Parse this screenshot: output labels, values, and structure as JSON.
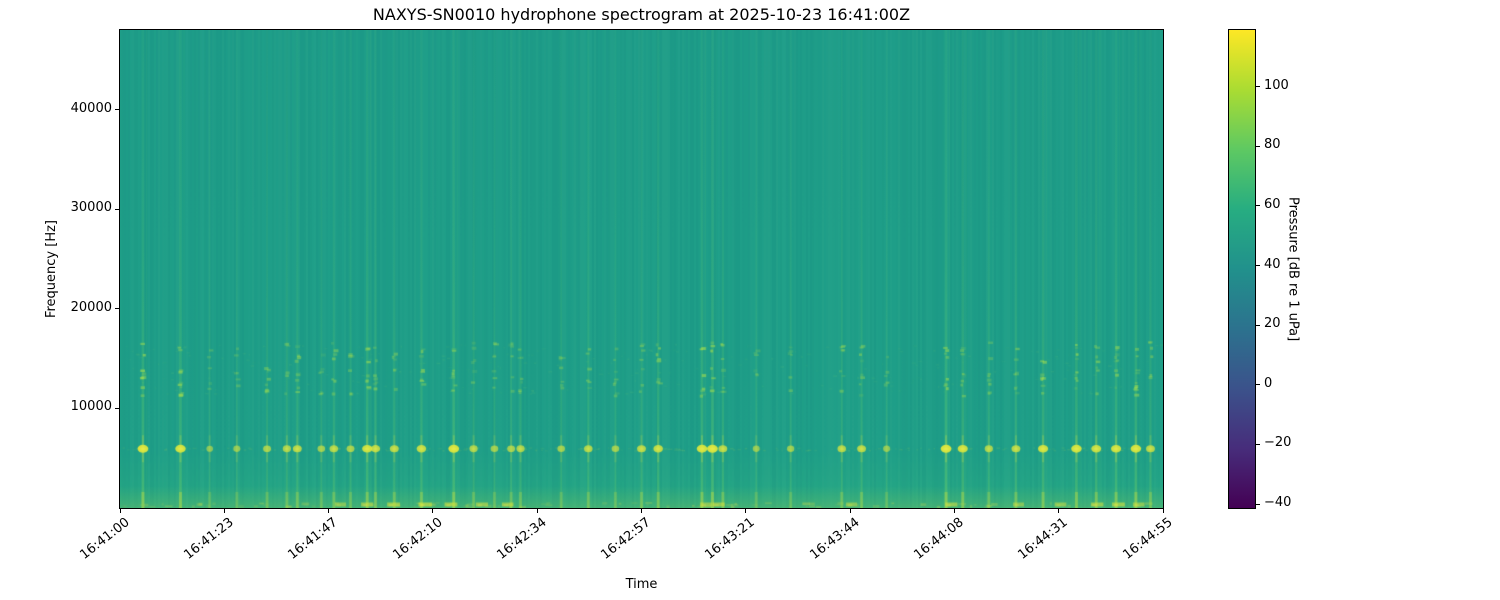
{
  "chart_data": {
    "type": "heatmap",
    "title": "NAXYS-SN0010 hydrophone spectrogram at 2025-10-23 16:41:00Z",
    "xlabel": "Time",
    "ylabel": "Frequency [Hz]",
    "x_ticks": [
      "16:41:00",
      "16:41:23",
      "16:41:47",
      "16:42:10",
      "16:42:34",
      "16:42:57",
      "16:43:21",
      "16:43:44",
      "16:44:08",
      "16:44:31",
      "16:44:55"
    ],
    "y_ticks": [
      10000,
      20000,
      30000,
      40000
    ],
    "freq_range_hz": [
      0,
      48000
    ],
    "colormap": "viridis",
    "background_level_db": 55,
    "tonal_band_hz": 6000,
    "speckle_bands_hz": [
      11800,
      12800,
      13800,
      15200,
      16300
    ],
    "colorbar": {
      "label": "Pressure [dB re 1 uPa]",
      "ticks": [
        100,
        80,
        60,
        40,
        20,
        0,
        -20,
        -40
      ],
      "range": [
        -41,
        119
      ],
      "stops": [
        "#440154",
        "#472d7b",
        "#3b528b",
        "#2c728e",
        "#21918c",
        "#27ad81",
        "#5ec962",
        "#aadc32",
        "#fde725"
      ]
    },
    "background_color": "#1f9f88",
    "streak_color": "#5ec962",
    "blob_color": "#dde52d",
    "events": [
      {
        "t": 0.022,
        "i": 1.0
      },
      {
        "t": 0.058,
        "i": 0.95
      },
      {
        "t": 0.086,
        "i": 0.35
      },
      {
        "t": 0.112,
        "i": 0.4
      },
      {
        "t": 0.141,
        "i": 0.55
      },
      {
        "t": 0.16,
        "i": 0.6
      },
      {
        "t": 0.17,
        "i": 0.7
      },
      {
        "t": 0.193,
        "i": 0.5
      },
      {
        "t": 0.205,
        "i": 0.65
      },
      {
        "t": 0.221,
        "i": 0.55
      },
      {
        "t": 0.237,
        "i": 0.9
      },
      {
        "t": 0.245,
        "i": 0.75
      },
      {
        "t": 0.263,
        "i": 0.7
      },
      {
        "t": 0.289,
        "i": 0.8
      },
      {
        "t": 0.32,
        "i": 1.0
      },
      {
        "t": 0.339,
        "i": 0.6
      },
      {
        "t": 0.359,
        "i": 0.5
      },
      {
        "t": 0.375,
        "i": 0.55
      },
      {
        "t": 0.384,
        "i": 0.6
      },
      {
        "t": 0.423,
        "i": 0.5
      },
      {
        "t": 0.449,
        "i": 0.65
      },
      {
        "t": 0.475,
        "i": 0.5
      },
      {
        "t": 0.5,
        "i": 0.7
      },
      {
        "t": 0.516,
        "i": 0.8
      },
      {
        "t": 0.558,
        "i": 0.95
      },
      {
        "t": 0.568,
        "i": 1.0
      },
      {
        "t": 0.578,
        "i": 0.7
      },
      {
        "t": 0.61,
        "i": 0.4
      },
      {
        "t": 0.643,
        "i": 0.45
      },
      {
        "t": 0.692,
        "i": 0.65
      },
      {
        "t": 0.711,
        "i": 0.7
      },
      {
        "t": 0.735,
        "i": 0.4
      },
      {
        "t": 0.792,
        "i": 1.0
      },
      {
        "t": 0.808,
        "i": 0.9
      },
      {
        "t": 0.833,
        "i": 0.6
      },
      {
        "t": 0.859,
        "i": 0.7
      },
      {
        "t": 0.885,
        "i": 0.9
      },
      {
        "t": 0.917,
        "i": 0.95
      },
      {
        "t": 0.936,
        "i": 0.85
      },
      {
        "t": 0.955,
        "i": 0.9
      },
      {
        "t": 0.974,
        "i": 0.95
      },
      {
        "t": 0.988,
        "i": 0.7
      }
    ],
    "bottom_patches": [
      {
        "t": 0.21,
        "i": 0.5
      },
      {
        "t": 0.235,
        "i": 0.7
      },
      {
        "t": 0.26,
        "i": 0.8
      },
      {
        "t": 0.29,
        "i": 0.9
      },
      {
        "t": 0.315,
        "i": 0.8
      },
      {
        "t": 0.345,
        "i": 0.7
      },
      {
        "t": 0.37,
        "i": 0.6
      },
      {
        "t": 0.56,
        "i": 0.6
      },
      {
        "t": 0.572,
        "i": 0.7
      },
      {
        "t": 0.7,
        "i": 0.5
      },
      {
        "t": 0.795,
        "i": 0.7
      },
      {
        "t": 0.86,
        "i": 0.5
      },
      {
        "t": 0.9,
        "i": 0.6
      },
      {
        "t": 0.935,
        "i": 0.7
      },
      {
        "t": 0.955,
        "i": 0.8
      },
      {
        "t": 0.975,
        "i": 0.6
      }
    ]
  }
}
